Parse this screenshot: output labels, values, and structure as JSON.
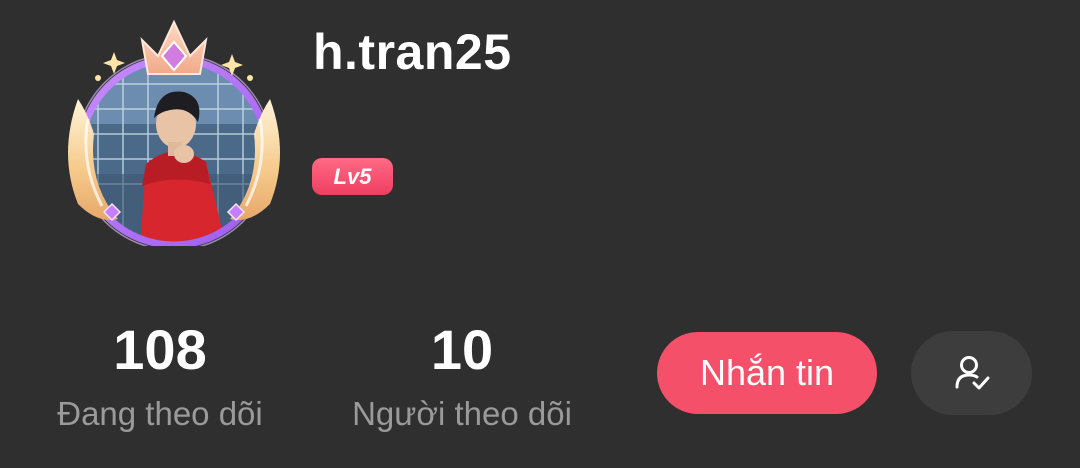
{
  "profile": {
    "username": "h.tran25",
    "level_badge": "Lv5",
    "avatar_icon": "user-avatar-with-crown-frame"
  },
  "stats": {
    "following_count": "108",
    "following_label": "Đang theo dõi",
    "followers_count": "10",
    "followers_label": "Người theo dõi"
  },
  "actions": {
    "message_label": "Nhắn tin",
    "followed_icon": "user-check-icon"
  },
  "colors": {
    "background": "#2f2f2f",
    "accent": "#f5506a",
    "level_badge": "#ee3f61",
    "secondary_button": "#3d3d3d",
    "muted_text": "#9a9a9a"
  }
}
